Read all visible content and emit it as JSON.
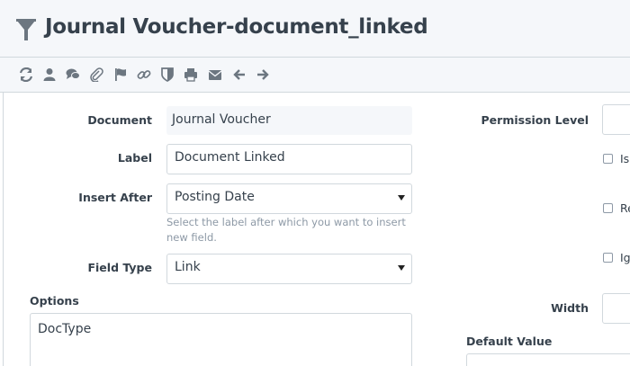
{
  "header": {
    "title": "Journal Voucher-document_linked"
  },
  "toolbar": {
    "icons": [
      "refresh-icon",
      "user-icon",
      "comments-icon",
      "attachment-icon",
      "flag-icon",
      "link-icon",
      "shield-icon",
      "print-icon",
      "email-icon",
      "arrow-left-icon",
      "arrow-right-icon"
    ]
  },
  "form": {
    "document": {
      "label": "Document",
      "value": "Journal Voucher"
    },
    "label_field": {
      "label": "Label",
      "value": "Document Linked"
    },
    "insert_after": {
      "label": "Insert After",
      "value": "Posting Date",
      "help": "Select the label after which you want to insert new field."
    },
    "field_type": {
      "label": "Field Type",
      "value": "Link"
    },
    "options": {
      "label": "Options",
      "value": "DocType"
    },
    "permission_level": {
      "label": "Permission Level"
    },
    "checkboxes": [
      "Is",
      "Re",
      "Ig"
    ],
    "width": {
      "label": "Width"
    },
    "default_value": {
      "label": "Default Value"
    }
  }
}
